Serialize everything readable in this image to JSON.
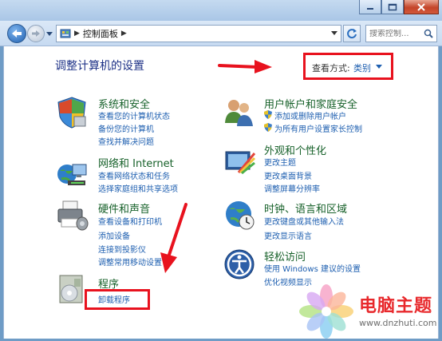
{
  "window": {
    "minimize_icon": "minimize-icon",
    "maximize_icon": "maximize-icon",
    "close_icon": "close-icon"
  },
  "navigation": {
    "breadcrumb": [
      "控制面板"
    ],
    "search_placeholder": "搜索控制..."
  },
  "header": {
    "title": "调整计算机的设置",
    "view_by_label": "查看方式:",
    "view_by_value": "类别"
  },
  "categories": {
    "system_security": {
      "title": "系统和安全",
      "links": [
        "查看您的计算机状态",
        "备份您的计算机",
        "查找并解决问题"
      ]
    },
    "network": {
      "title": "网络和 Internet",
      "links": [
        "查看网络状态和任务",
        "选择家庭组和共享选项"
      ]
    },
    "hardware": {
      "title": "硬件和声音",
      "links": [
        "查看设备和打印机",
        "添加设备",
        "连接到投影仪",
        "调整常用移动设置"
      ]
    },
    "programs": {
      "title": "程序",
      "links": [
        "卸载程序"
      ]
    },
    "user_accounts": {
      "title": "用户帐户和家庭安全",
      "links": [
        "添加或删除用户帐户",
        "为所有用户设置家长控制"
      ]
    },
    "appearance": {
      "title": "外观和个性化",
      "links": [
        "更改主题",
        "更改桌面背景",
        "调整屏幕分辨率"
      ]
    },
    "clock": {
      "title": "时钟、语言和区域",
      "links": [
        "更改键盘或其他输入法",
        "更改显示语言"
      ]
    },
    "ease": {
      "title": "轻松访问",
      "links": [
        "使用 Windows 建议的设置",
        "优化视频显示"
      ]
    }
  },
  "watermark": {
    "title": "电脑主题",
    "url": "www.dnzhuti.com"
  },
  "colors": {
    "annotation_red": "#e8121e",
    "category_green": "#17612a",
    "link_blue": "#1e5fb0"
  }
}
